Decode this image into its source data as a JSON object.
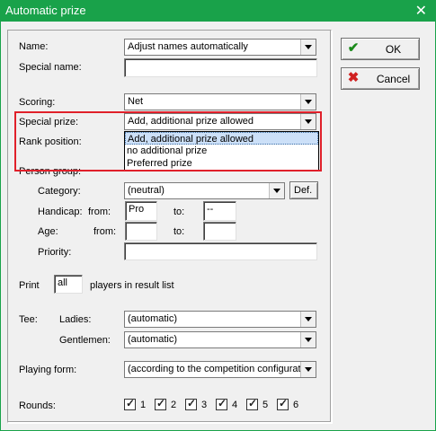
{
  "window": {
    "title": "Automatic prize",
    "close_glyph": "✕"
  },
  "buttons": {
    "ok": "OK",
    "cancel": "Cancel",
    "def": "Def."
  },
  "labels": {
    "name": "Name:",
    "special_name": "Special name:",
    "scoring": "Scoring:",
    "special_prize": "Special prize:",
    "rank_position": "Rank position:",
    "person_group": "Person group:",
    "category": "Category:",
    "handicap": "Handicap:",
    "from": "from:",
    "to": "to:",
    "age": "Age:",
    "priority": "Priority:",
    "print": "Print",
    "players_in_result": "players in result list",
    "tee": "Tee:",
    "ladies": "Ladies:",
    "gentlemen": "Gentlemen:",
    "playing_form": "Playing form:",
    "rounds": "Rounds:"
  },
  "values": {
    "name": "Adjust names automatically",
    "special_name": "",
    "scoring": "Net",
    "special_prize": "Add, additional prize allowed",
    "category": "(neutral)",
    "handicap_from": "Pro",
    "handicap_to": "--",
    "age_from": "",
    "age_to": "",
    "priority": "",
    "print_count": "all",
    "tee_ladies": "(automatic)",
    "tee_gentlemen": "(automatic)",
    "playing_form": "(according to the competition configurati"
  },
  "special_prize_options": [
    "Add, additional prize allowed",
    "no additional prize",
    "Preferred prize"
  ],
  "rounds": [
    "1",
    "2",
    "3",
    "4",
    "5",
    "6"
  ],
  "colors": {
    "titlebar": "#19a24a",
    "highlight_box": "#e0202a",
    "ok_icon": "#1a8a1a",
    "cancel_icon": "#d02020"
  }
}
